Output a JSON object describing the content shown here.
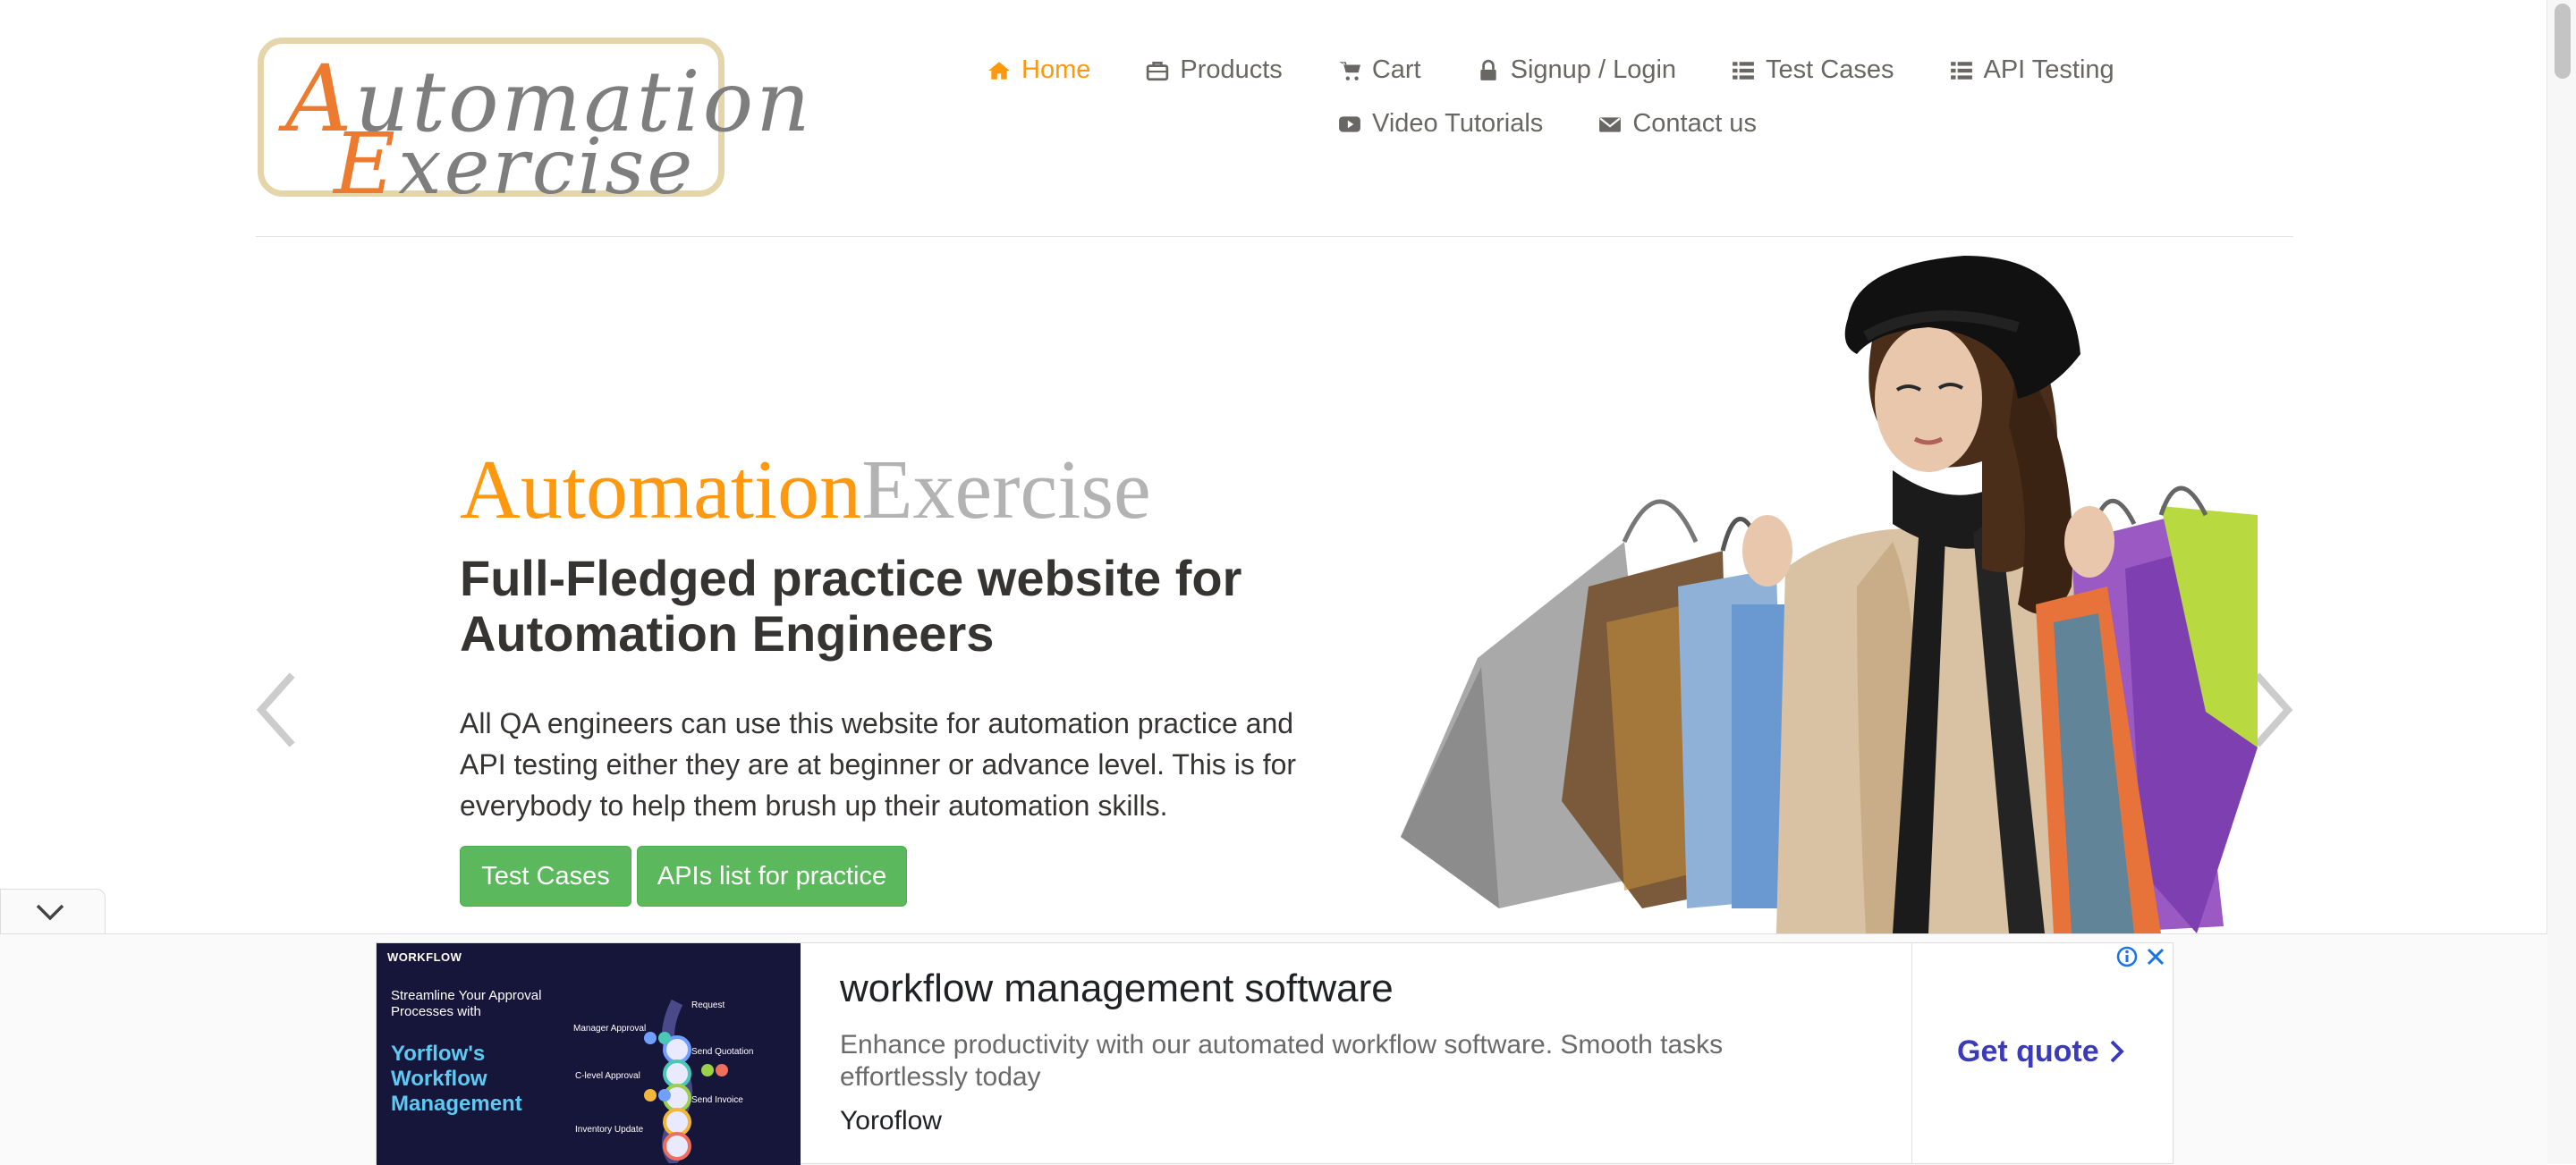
{
  "logo": {
    "line1_cap": "A",
    "line1_rest": "utomation",
    "line2_cap": "E",
    "line2_rest": "xercise"
  },
  "nav": {
    "items": [
      {
        "label": "Home",
        "icon": "home-icon",
        "active": true
      },
      {
        "label": "Products",
        "icon": "products-icon"
      },
      {
        "label": "Cart",
        "icon": "cart-icon"
      },
      {
        "label": "Signup / Login",
        "icon": "lock-icon"
      },
      {
        "label": "Test Cases",
        "icon": "list-icon"
      },
      {
        "label": "API Testing",
        "icon": "list-icon"
      },
      {
        "label": "Video Tutorials",
        "icon": "youtube-play-icon"
      },
      {
        "label": "Contact us",
        "icon": "envelope-icon"
      }
    ]
  },
  "hero": {
    "title_part1": "Automation",
    "title_part2": "Exercise",
    "subtitle": "Full-Fledged practice website for Automation Engineers",
    "description": "All QA engineers can use this website for automation practice and API testing either they are at beginner or advance level. This is for everybody to help them brush up their automation skills.",
    "buttons": {
      "test_cases": "Test Cases",
      "apis_list": "APIs list for practice"
    }
  },
  "ad": {
    "image": {
      "brand": "WORKFLOW",
      "tagline": "Streamline Your Approval Processes with",
      "product": "Yorflow's Workflow Management",
      "steps": [
        "Request",
        "Manager Approval",
        "Send Quotation",
        "C-level Approval",
        "Send Invoice",
        "Inventory Update"
      ]
    },
    "headline": "workflow management software",
    "description": "Enhance productivity with our automated workflow software. Smooth tasks effortlessly today",
    "advertiser": "Yoroflow",
    "cta": "Get quote"
  },
  "colors": {
    "accent": "#fe980f",
    "button": "#5cb85c",
    "text": "#696763",
    "cta": "#3b3bba"
  }
}
